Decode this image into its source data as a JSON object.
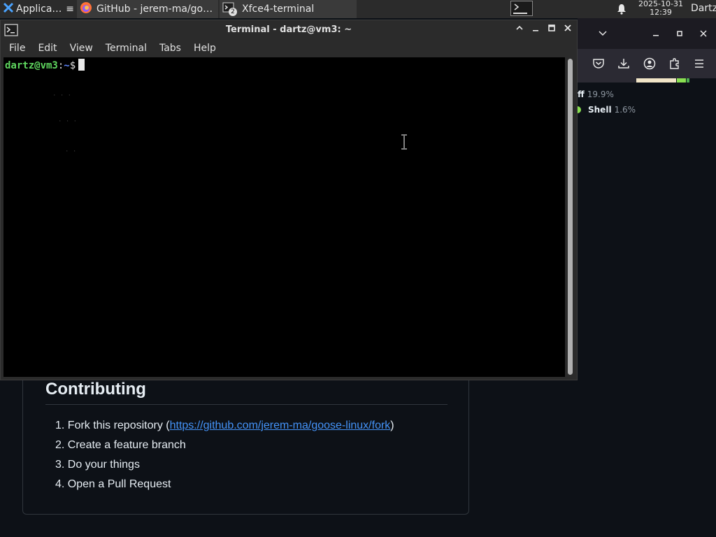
{
  "panel": {
    "applications_label": "Applications",
    "tasks": [
      {
        "label": "GitHub - jerem-ma/goos...",
        "icon": "firefox-icon"
      },
      {
        "label": "Xfce4-terminal",
        "icon": "terminal-icon",
        "badge": "2"
      }
    ],
    "clock_date": "2025-10-31",
    "clock_time": "12:39",
    "user": "Dartz"
  },
  "terminal": {
    "title": "Terminal - dartz@vm3: ~",
    "menu": [
      "File",
      "Edit",
      "View",
      "Terminal",
      "Tabs",
      "Help"
    ],
    "prompt_user": "dartz@vm3",
    "prompt_colon": ":",
    "prompt_path": "~",
    "prompt_symbol": "$"
  },
  "firefox": {
    "languages": [
      {
        "name": "ff",
        "percent": "19.9%"
      },
      {
        "name": "Shell",
        "percent": "1.6%"
      }
    ]
  },
  "readme": {
    "heading": "Contributing",
    "steps": {
      "s1_prefix": "1. Fork this repository (",
      "s1_link": "https://github.com/jerem-ma/goose-linux/fork",
      "s1_suffix": ")",
      "s2": "2. Create a feature branch",
      "s3": "3. Do your things",
      "s4": "4. Open a Pull Request"
    }
  },
  "colors": {
    "terminal_bg": "#000000",
    "prompt_user": "#5fd75f",
    "prompt_path": "#5f87ff",
    "link": "#4493f8",
    "page_bg": "#0d1117"
  }
}
